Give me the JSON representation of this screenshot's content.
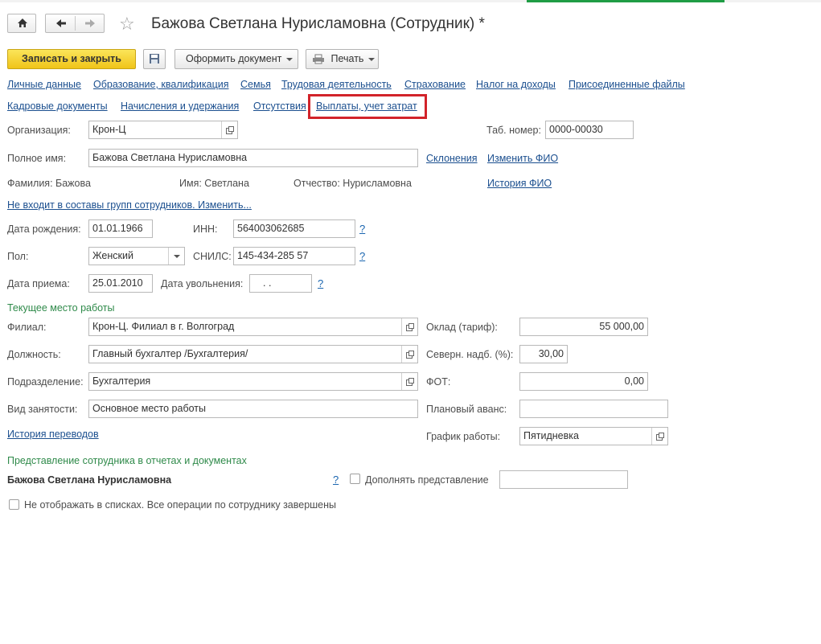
{
  "window": {
    "title": "Бажова Светлана Нурисламовна (Сотрудник) *"
  },
  "toolbar": {
    "save_close_label": "Записать и закрыть",
    "create_doc_label": "Оформить документ",
    "print_label": "Печать"
  },
  "nav_links": {
    "row1": [
      "Личные данные",
      "Образование, квалификация",
      "Семья",
      "Трудовая деятельность",
      "Страхование",
      "Налог на доходы",
      "Присоединенные файлы"
    ],
    "row2": [
      "Кадровые документы",
      "Начисления и удержания",
      "Отсутствия",
      "Выплаты, учет затрат"
    ]
  },
  "form": {
    "organization_label": "Организация:",
    "organization_value": "Крон-Ц",
    "tab_number_label": "Таб. номер:",
    "tab_number_value": "0000-00030",
    "full_name_label": "Полное имя:",
    "full_name_value": "Бажова Светлана Нурисламовна",
    "declensions_link": "Склонения",
    "change_name_link": "Изменить ФИО",
    "surname_text": "Фамилия: Бажова",
    "name_text": "Имя: Светлана",
    "patronymic_text": "Отчество: Нурисламовна",
    "name_history_link": "История ФИО",
    "groups_link": "Не входит в составы групп сотрудников. Изменить...",
    "birth_date_label": "Дата рождения:",
    "birth_date_value": "01.01.1966",
    "inn_label": "ИНН:",
    "inn_value": "564003062685",
    "gender_label": "Пол:",
    "gender_value": "Женский",
    "snils_label": "СНИЛС:",
    "snils_value": "145-434-285 57",
    "hire_date_label": "Дата приема:",
    "hire_date_value": "25.01.2010",
    "dismissal_label": "Дата увольнения:",
    "dismissal_value": " .  .",
    "question_mark": "?"
  },
  "workplace": {
    "section_title": "Текущее место работы",
    "branch_label": "Филиал:",
    "branch_value": "Крон-Ц. Филиал в г. Волгоград",
    "position_label": "Должность:",
    "position_value": "Главный бухгалтер /Бухгалтерия/",
    "department_label": "Подразделение:",
    "department_value": "Бухгалтерия",
    "employment_label": "Вид занятости:",
    "employment_value": "Основное место работы",
    "transfers_link": "История переводов",
    "salary_label": "Оклад (тариф):",
    "salary_value": "55 000,00",
    "north_label": "Северн. надб. (%):",
    "north_value": "30,00",
    "fot_label": "ФОТ:",
    "fot_value": "0,00",
    "advance_label": "Плановый аванс:",
    "advance_value": "",
    "schedule_label": "График работы:",
    "schedule_value": "Пятидневка"
  },
  "representation": {
    "section_title": "Представление сотрудника в отчетах и документах",
    "name": "Бажова Светлана Нурисламовна",
    "supplement_label": "Дополнять представление",
    "supplement_value": "",
    "hide_label": "Не отображать в списках. Все операции по сотруднику завершены"
  }
}
